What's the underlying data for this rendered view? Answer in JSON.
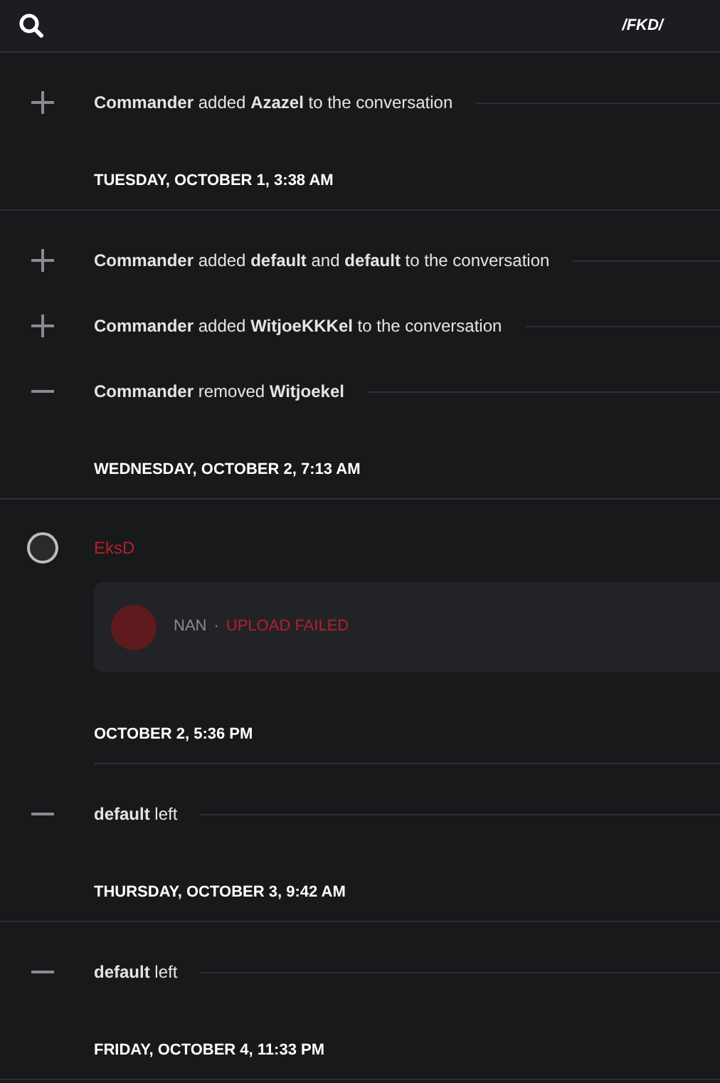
{
  "header": {
    "title": "/FKD/"
  },
  "groups": [
    {
      "kind": "day",
      "entries": [
        {
          "kind": "added",
          "text": "**Commander** added **Azazel** to the conversation"
        }
      ],
      "timestamp": "TUESDAY, OCTOBER 1, 3:38 AM"
    },
    {
      "kind": "day",
      "entries": [
        {
          "kind": "added",
          "text": "**Commander** added **default** and **default** to the conversation"
        },
        {
          "kind": "added",
          "text": "**Commander** added **WitjoeKKKel** to the conversation"
        },
        {
          "kind": "removed",
          "text": "**Commander** removed **Witjoekel**"
        }
      ],
      "timestamp": "WEDNESDAY, OCTOBER 2, 7:13 AM"
    },
    {
      "kind": "time",
      "entries": [
        {
          "kind": "message",
          "author": "EksD",
          "attachment": {
            "name": "NAN",
            "separator": "·",
            "status": "UPLOAD FAILED"
          }
        }
      ],
      "timestamp": "OCTOBER 2, 5:36 PM"
    },
    {
      "kind": "day",
      "entries": [
        {
          "kind": "removed",
          "text": "**default** left"
        }
      ],
      "timestamp": "THURSDAY, OCTOBER 3, 9:42 AM"
    },
    {
      "kind": "day",
      "entries": [
        {
          "kind": "removed",
          "text": "**default** left"
        }
      ],
      "timestamp": "FRIDAY, OCTOBER 4, 11:33 PM"
    }
  ]
}
